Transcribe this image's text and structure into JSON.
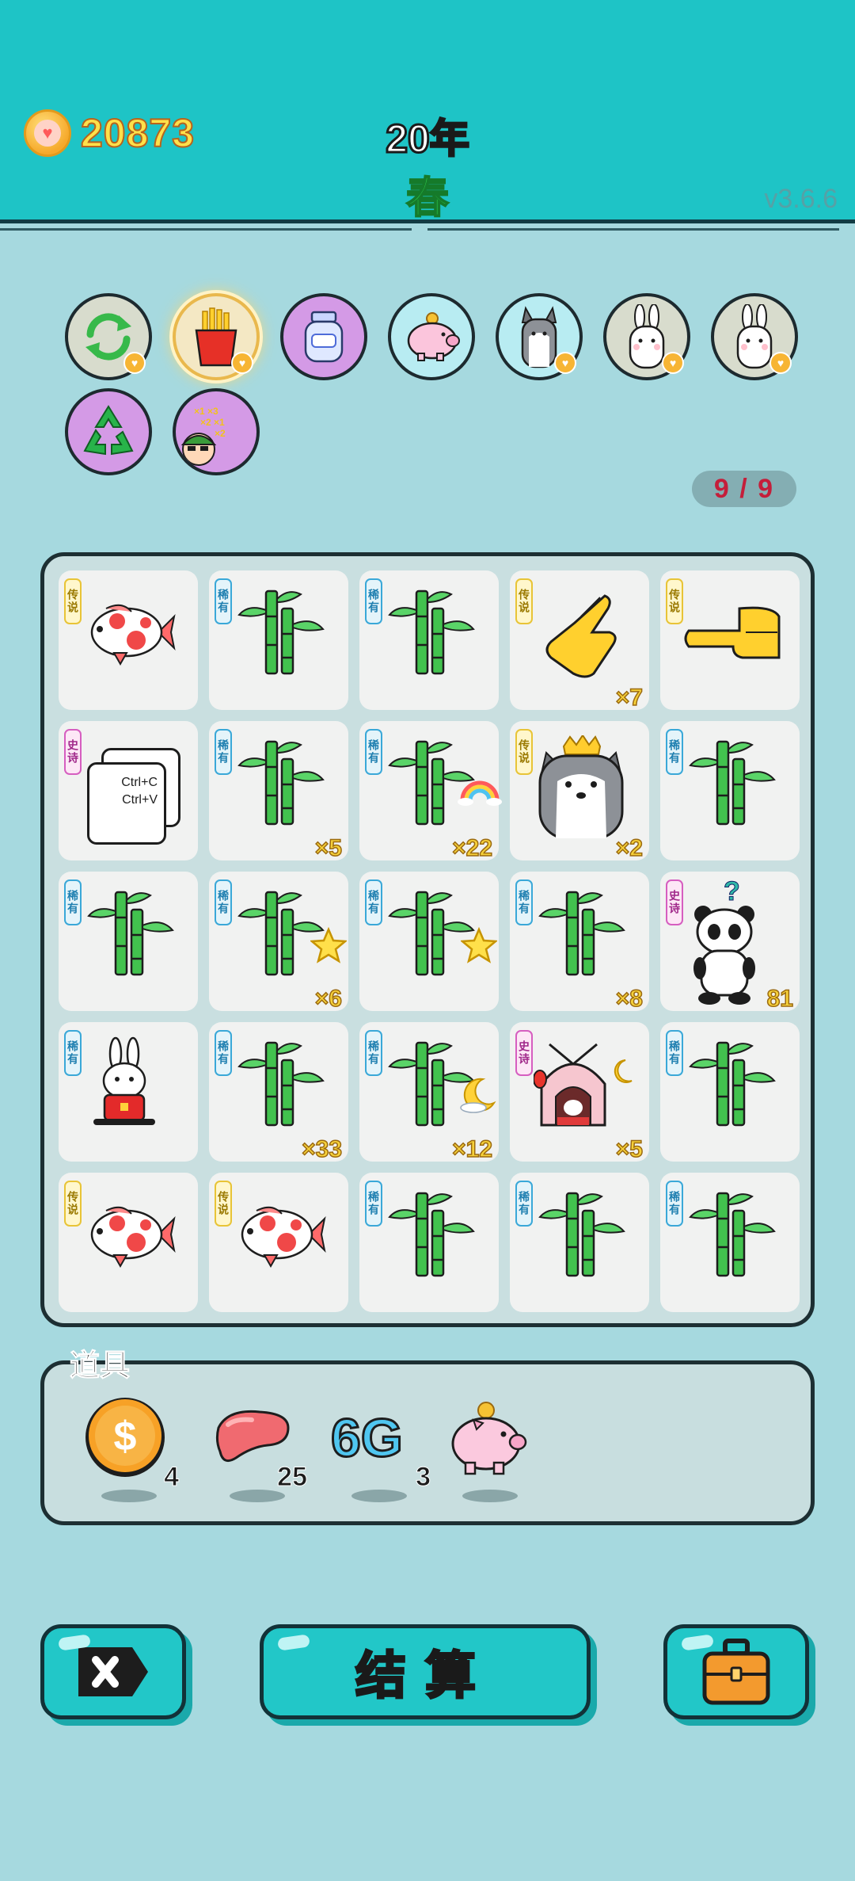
{
  "header": {
    "coins": "20873",
    "year": "20年",
    "season": "春",
    "version": "v3.6.6"
  },
  "item_icons": [
    {
      "name": "refresh-icon",
      "bg": "#d8dccd"
    },
    {
      "name": "fries-icon",
      "bg": "#f4e8c4"
    },
    {
      "name": "jar-icon",
      "bg": "#d49ae6"
    },
    {
      "name": "piggy-bank-icon",
      "bg": "#b8ecf2"
    },
    {
      "name": "husky-icon",
      "bg": "#b8ecf2"
    },
    {
      "name": "rabbit-icon",
      "bg": "#d8dccd"
    },
    {
      "name": "rabbit-icon",
      "bg": "#d8dccd"
    },
    {
      "name": "recycle-icon",
      "bg": "#d49ae6"
    },
    {
      "name": "multiplier-icon",
      "bg": "#d49ae6"
    }
  ],
  "counter": "9 / 9",
  "tags": {
    "legend": "传说",
    "rare": "稀有",
    "epic": "史诗"
  },
  "board": [
    {
      "tag": "传说",
      "art": "koi",
      "count": ""
    },
    {
      "tag": "稀有",
      "art": "bamboo",
      "count": ""
    },
    {
      "tag": "稀有",
      "art": "bamboo",
      "count": ""
    },
    {
      "tag": "传说",
      "art": "hand-point",
      "count": "×7"
    },
    {
      "tag": "传说",
      "art": "hand-side",
      "count": ""
    },
    {
      "tag": "史诗",
      "art": "ctrl",
      "count": ""
    },
    {
      "tag": "稀有",
      "art": "bamboo",
      "count": "×5"
    },
    {
      "tag": "稀有",
      "art": "bamboo-rainbow",
      "count": "×22"
    },
    {
      "tag": "传说",
      "art": "husky-king",
      "count": "×2"
    },
    {
      "tag": "稀有",
      "art": "bamboo",
      "count": ""
    },
    {
      "tag": "稀有",
      "art": "bamboo",
      "count": ""
    },
    {
      "tag": "稀有",
      "art": "bamboo-star",
      "count": "×6"
    },
    {
      "tag": "稀有",
      "art": "bamboo-star",
      "count": ""
    },
    {
      "tag": "稀有",
      "art": "bamboo",
      "count": "×8"
    },
    {
      "tag": "史诗",
      "art": "panda",
      "count": "81"
    },
    {
      "tag": "稀有",
      "art": "rabbit-red",
      "count": ""
    },
    {
      "tag": "稀有",
      "art": "bamboo",
      "count": "×33"
    },
    {
      "tag": "稀有",
      "art": "bamboo-moon",
      "count": "×12"
    },
    {
      "tag": "史诗",
      "art": "rabbit-house",
      "count": "×5"
    },
    {
      "tag": "稀有",
      "art": "bamboo",
      "count": ""
    },
    {
      "tag": "传说",
      "art": "koi",
      "count": ""
    },
    {
      "tag": "传说",
      "art": "koi",
      "count": ""
    },
    {
      "tag": "稀有",
      "art": "bamboo",
      "count": ""
    },
    {
      "tag": "稀有",
      "art": "bamboo",
      "count": ""
    },
    {
      "tag": "稀有",
      "art": "bamboo",
      "count": ""
    }
  ],
  "ctrl_text": {
    "line1": "Ctrl+C",
    "line2": "Ctrl+V"
  },
  "panda_question": "?",
  "props": {
    "title": "道具",
    "items": [
      {
        "name": "dollar-coin-icon",
        "count": "4"
      },
      {
        "name": "liver-icon",
        "count": "25"
      },
      {
        "name": "6g-icon",
        "label": "6G",
        "count": "3"
      },
      {
        "name": "piggy-bank-icon",
        "count": ""
      }
    ]
  },
  "buttons": {
    "settle_label": "结算"
  },
  "colors": {
    "header": "#1ec4c6",
    "background": "#a6d9df",
    "gold": "#f6d13a",
    "button": "#22c7c8"
  }
}
